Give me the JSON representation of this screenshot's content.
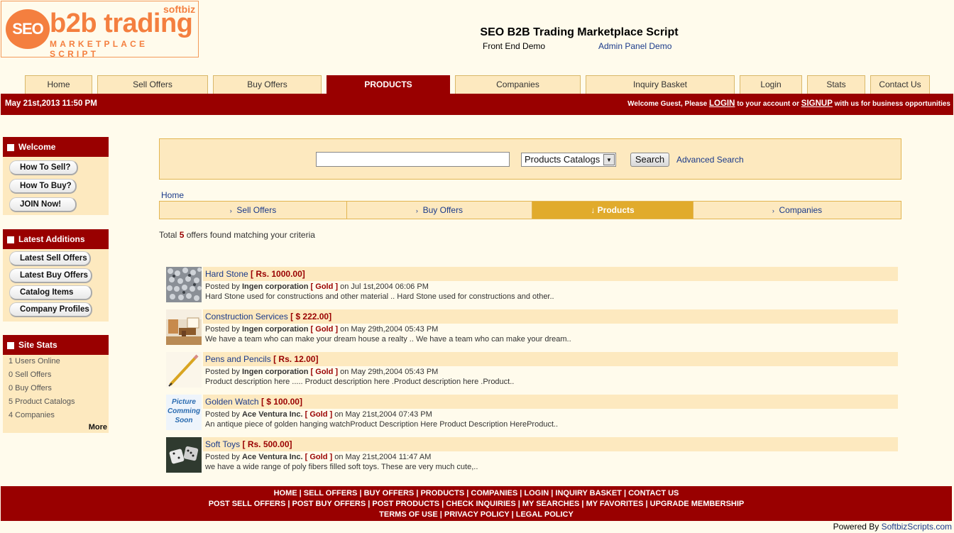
{
  "logo": {
    "seo": "SEO",
    "b2b": "b2b trading",
    "softbiz": "softbiz",
    "sub": "MARKETPLACE SCRIPT"
  },
  "header": {
    "title": "SEO B2B Trading Marketplace Script",
    "front_end": "Front End Demo",
    "admin": "Admin Panel Demo"
  },
  "tabs": [
    "Home",
    "Sell Offers",
    "Buy Offers",
    "PRODUCTS",
    "Companies",
    "Inquiry Basket",
    "Login",
    "Stats",
    "Contact Us"
  ],
  "datebar": {
    "date": "May 21st,2013 11:50 PM",
    "welcome_pre": "Welcome Guest, Please ",
    "login": "LOGIN",
    "welcome_mid": " to your account or ",
    "signup": "SIGNUP",
    "welcome_post": " with us for business opportunities"
  },
  "sidebar": {
    "welcome": {
      "title": "Welcome",
      "items": [
        "How To Sell?",
        "How To Buy?",
        "JOIN Now!"
      ]
    },
    "latest": {
      "title": "Latest Additions",
      "items": [
        "Latest Sell Offers",
        "Latest Buy Offers",
        "Catalog Items",
        "Company Profiles"
      ]
    },
    "stats": {
      "title": "Site Stats",
      "items": [
        "1 Users Online",
        "0 Sell Offers",
        "0 Buy Offers",
        "5 Product Catalogs",
        "4 Companies"
      ],
      "more": "More"
    }
  },
  "search": {
    "select": "Products Catalogs",
    "button": "Search",
    "advanced": "Advanced Search",
    "value": ""
  },
  "breadcrumb": "Home",
  "subtabs": [
    "Sell Offers",
    "Buy Offers",
    "Products",
    "Companies"
  ],
  "total": {
    "pre": "Total ",
    "count": "5",
    "post": " offers found matching your criteria"
  },
  "items": [
    {
      "title": "Hard Stone",
      "price": "[ Rs. 1000.00]",
      "by": "Ingen corporation",
      "level": "[ Gold ]",
      "date": "on Jul 1st,2004 06:06 PM",
      "desc": "Hard Stone used for constructions and other material .. Hard Stone used for constructions and other.."
    },
    {
      "title": "Construction Services",
      "price": "[ $ 222.00]",
      "by": "Ingen corporation",
      "level": "[ Gold ]",
      "date": "on May 29th,2004 05:43 PM",
      "desc": "We have a team who can make your dream house a realty .. We have a team who can make your dream.."
    },
    {
      "title": "Pens and Pencils",
      "price": "[ Rs. 12.00]",
      "by": "Ingen corporation",
      "level": "[ Gold ]",
      "date": "on May 29th,2004 05:43 PM",
      "desc": "Product description here ..... Product description here .Product description here .Product.."
    },
    {
      "title": "Golden Watch",
      "price": "[ $ 100.00]",
      "by": "Ace Ventura Inc.",
      "level": "[ Gold ]",
      "date": "on May 21st,2004 07:43 PM",
      "desc": "An antique piece of golden hanging watchProduct Description Here Product Description HereProduct.."
    },
    {
      "title": "Soft Toys",
      "price": "[ Rs. 500.00]",
      "by": "Ace Ventura Inc.",
      "level": "[ Gold ]",
      "date": "on May 21st,2004 11:47 AM",
      "desc": "we have a wide range of  poly fibers filled soft toys. These are very much cute,.."
    }
  ],
  "posted_by": "Posted by ",
  "picture_soon": "Picture Comming Soon",
  "footer": {
    "row1": "HOME | SELL OFFERS | BUY OFFERS | PRODUCTS | COMPANIES | LOGIN | INQUIRY BASKET | CONTACT US",
    "row2": "POST SELL OFFERS | POST BUY OFFERS | POST PRODUCTS | CHECK INQUIRIES | MY SEARCHES | MY FAVORITES | UPGRADE MEMBERSHIP",
    "row3": "TERMS OF USE | PRIVACY POLICY | LEGAL POLICY"
  },
  "powered": {
    "pre": "Powered By ",
    "link": "SoftbizScripts.com"
  },
  "colors": {
    "brand": "#990000",
    "tab_bg": "#fde9bf",
    "accent": "#e1ab2c",
    "logo": "#f47f3f"
  }
}
